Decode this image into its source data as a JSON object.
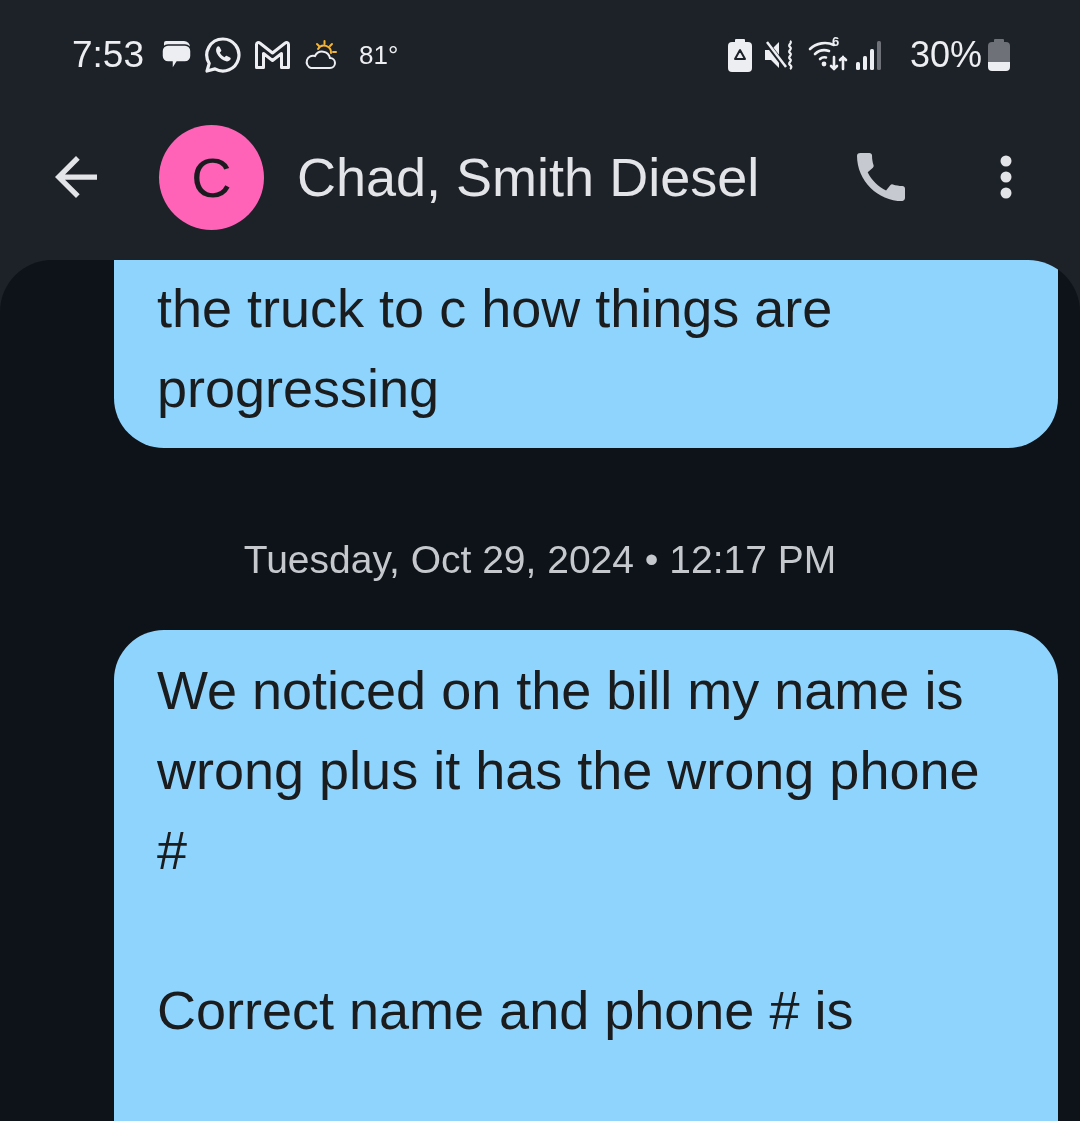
{
  "status_bar": {
    "time": "7:53",
    "temperature": "81°",
    "wifi_standard": "6",
    "battery_percent": "30%"
  },
  "header": {
    "avatar_letter": "C",
    "contact_name": "Chad, Smith Diesel"
  },
  "conversation": [
    {
      "kind": "message",
      "paragraphs": [
        [
          "the truck to c how things are",
          "progressing"
        ]
      ]
    },
    {
      "kind": "timestamp",
      "text": "Tuesday, Oct 29, 2024 • 12:17 PM"
    },
    {
      "kind": "message",
      "paragraphs": [
        [
          "We noticed on the bill my name is",
          "wrong plus it has the wrong phone",
          "#"
        ],
        [
          "Correct name and phone # is"
        ]
      ]
    }
  ]
}
